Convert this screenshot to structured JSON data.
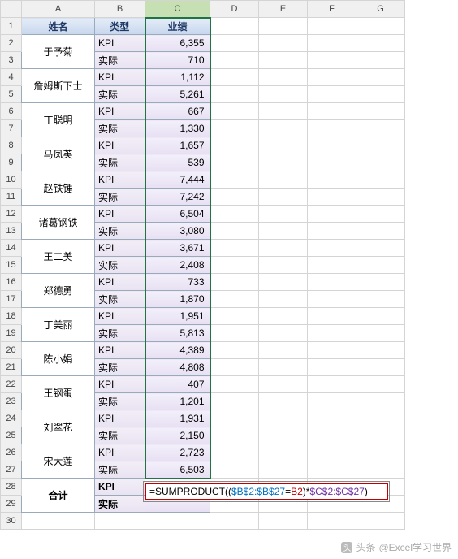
{
  "columns": [
    "",
    "A",
    "B",
    "C",
    "D",
    "E",
    "F",
    "G"
  ],
  "headers": {
    "A": "姓名",
    "B": "类型",
    "C": "业绩"
  },
  "people": [
    {
      "name": "于予菊",
      "kpi": "6,355",
      "actual": "710"
    },
    {
      "name": "詹姆斯下士",
      "kpi": "1,112",
      "actual": "5,261"
    },
    {
      "name": "丁聪明",
      "kpi": "667",
      "actual": "1,330"
    },
    {
      "name": "马凤英",
      "kpi": "1,657",
      "actual": "539"
    },
    {
      "name": "赵铁锤",
      "kpi": "7,444",
      "actual": "7,242"
    },
    {
      "name": "诸葛钢铁",
      "kpi": "6,504",
      "actual": "3,080"
    },
    {
      "name": "王二美",
      "kpi": "3,671",
      "actual": "2,408"
    },
    {
      "name": "郑德勇",
      "kpi": "733",
      "actual": "1,870"
    },
    {
      "name": "丁美丽",
      "kpi": "1,951",
      "actual": "5,813"
    },
    {
      "name": "陈小娟",
      "kpi": "4,389",
      "actual": "4,808"
    },
    {
      "name": "王钢蛋",
      "kpi": "407",
      "actual": "1,201"
    },
    {
      "name": "刘翠花",
      "kpi": "1,931",
      "actual": "2,150"
    },
    {
      "name": "宋大莲",
      "kpi": "2,723",
      "actual": "6,503"
    }
  ],
  "labels": {
    "kpi": "KPI",
    "actual": "实际",
    "total": "合计"
  },
  "formula": {
    "prefix": "=SUMPRODUCT((",
    "range1": "$B$2:$B$27",
    "eq": "=",
    "b2": "B2",
    "mid": ")*",
    "range2": "$C$2:$C$27",
    "suffix": ")"
  },
  "watermark": {
    "icon": "头",
    "pre": "头条",
    "text": "@Excel学习世界"
  },
  "chart_data": {
    "type": "table",
    "title": "业绩",
    "columns": [
      "姓名",
      "类型",
      "业绩"
    ],
    "rows": [
      [
        "于予菊",
        "KPI",
        6355
      ],
      [
        "于予菊",
        "实际",
        710
      ],
      [
        "詹姆斯下士",
        "KPI",
        1112
      ],
      [
        "詹姆斯下士",
        "实际",
        5261
      ],
      [
        "丁聪明",
        "KPI",
        667
      ],
      [
        "丁聪明",
        "实际",
        1330
      ],
      [
        "马凤英",
        "KPI",
        1657
      ],
      [
        "马凤英",
        "实际",
        539
      ],
      [
        "赵铁锤",
        "KPI",
        7444
      ],
      [
        "赵铁锤",
        "实际",
        7242
      ],
      [
        "诸葛钢铁",
        "KPI",
        6504
      ],
      [
        "诸葛钢铁",
        "实际",
        3080
      ],
      [
        "王二美",
        "KPI",
        3671
      ],
      [
        "王二美",
        "实际",
        2408
      ],
      [
        "郑德勇",
        "KPI",
        733
      ],
      [
        "郑德勇",
        "实际",
        1870
      ],
      [
        "丁美丽",
        "KPI",
        1951
      ],
      [
        "丁美丽",
        "实际",
        5813
      ],
      [
        "陈小娟",
        "KPI",
        4389
      ],
      [
        "陈小娟",
        "实际",
        4808
      ],
      [
        "王钢蛋",
        "KPI",
        407
      ],
      [
        "王钢蛋",
        "实际",
        1201
      ],
      [
        "刘翠花",
        "KPI",
        1931
      ],
      [
        "刘翠花",
        "实际",
        2150
      ],
      [
        "宋大莲",
        "KPI",
        2723
      ],
      [
        "宋大莲",
        "实际",
        6503
      ]
    ]
  }
}
